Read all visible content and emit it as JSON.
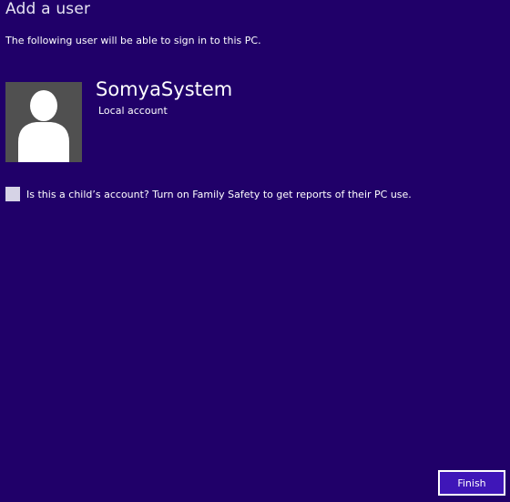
{
  "header": {
    "title": "Add a user",
    "subtitle": "The following user will be able to sign in to this PC."
  },
  "user": {
    "avatar_icon": "default-user-silhouette-icon",
    "name": "SomyaSystem",
    "account_type": "Local account"
  },
  "family_safety": {
    "checked": false,
    "label": "Is this a child’s account? Turn on Family Safety to get reports of their PC use."
  },
  "footer": {
    "finish_label": "Finish"
  },
  "colors": {
    "background": "#200069",
    "button_fill": "#3f16b8",
    "avatar_bg": "#505050"
  }
}
